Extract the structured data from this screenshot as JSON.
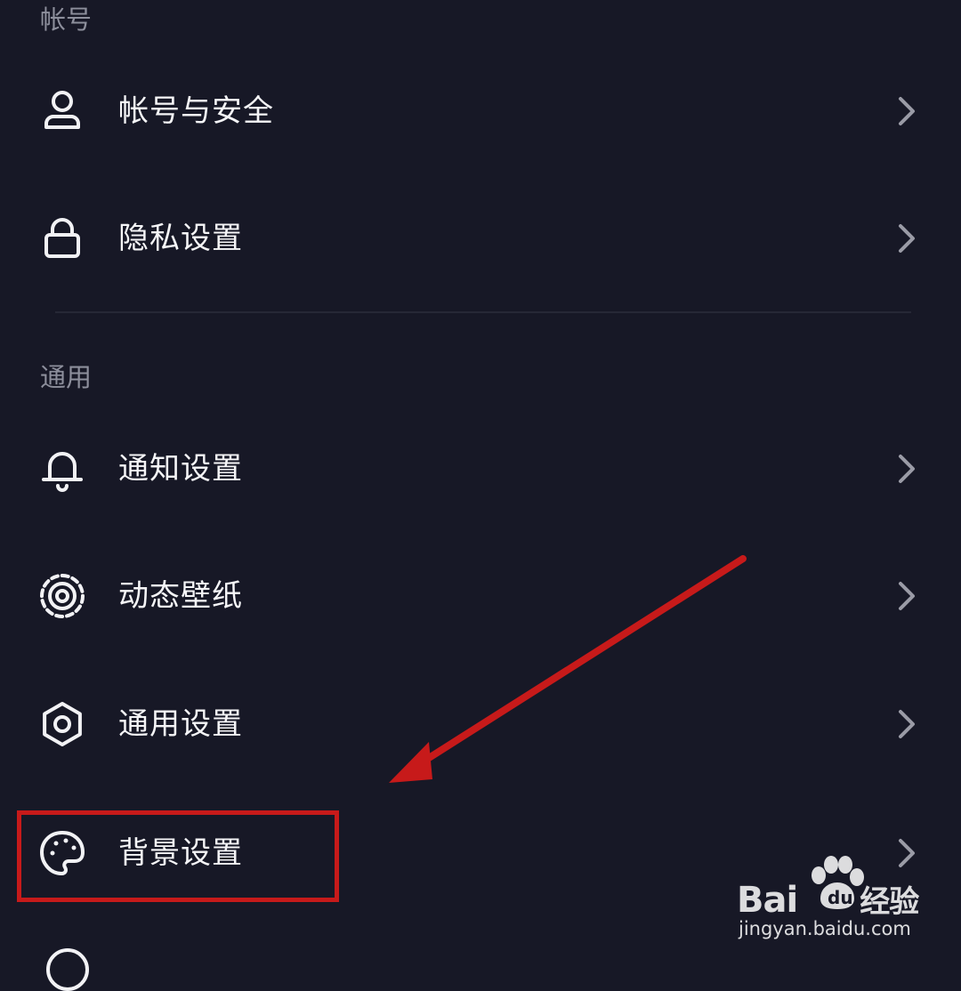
{
  "sections": {
    "account": "帐号",
    "general": "通用"
  },
  "items": [
    {
      "label": "帐号与安全",
      "icon": "person-icon"
    },
    {
      "label": "隐私设置",
      "icon": "lock-icon"
    },
    {
      "label": "通知设置",
      "icon": "bell-icon"
    },
    {
      "label": "动态壁纸",
      "icon": "live-wallpaper-icon"
    },
    {
      "label": "通用设置",
      "icon": "gear-icon"
    },
    {
      "label": "背景设置",
      "icon": "palette-icon"
    }
  ],
  "watermark": {
    "brand_left": "Bai",
    "brand_right": "经验",
    "url": "jingyan.baidu.com"
  },
  "colors": {
    "background": "#171826",
    "text": "#f5f5f7",
    "section_text": "#8d8f9c",
    "annotation_red": "#c71a1a"
  }
}
